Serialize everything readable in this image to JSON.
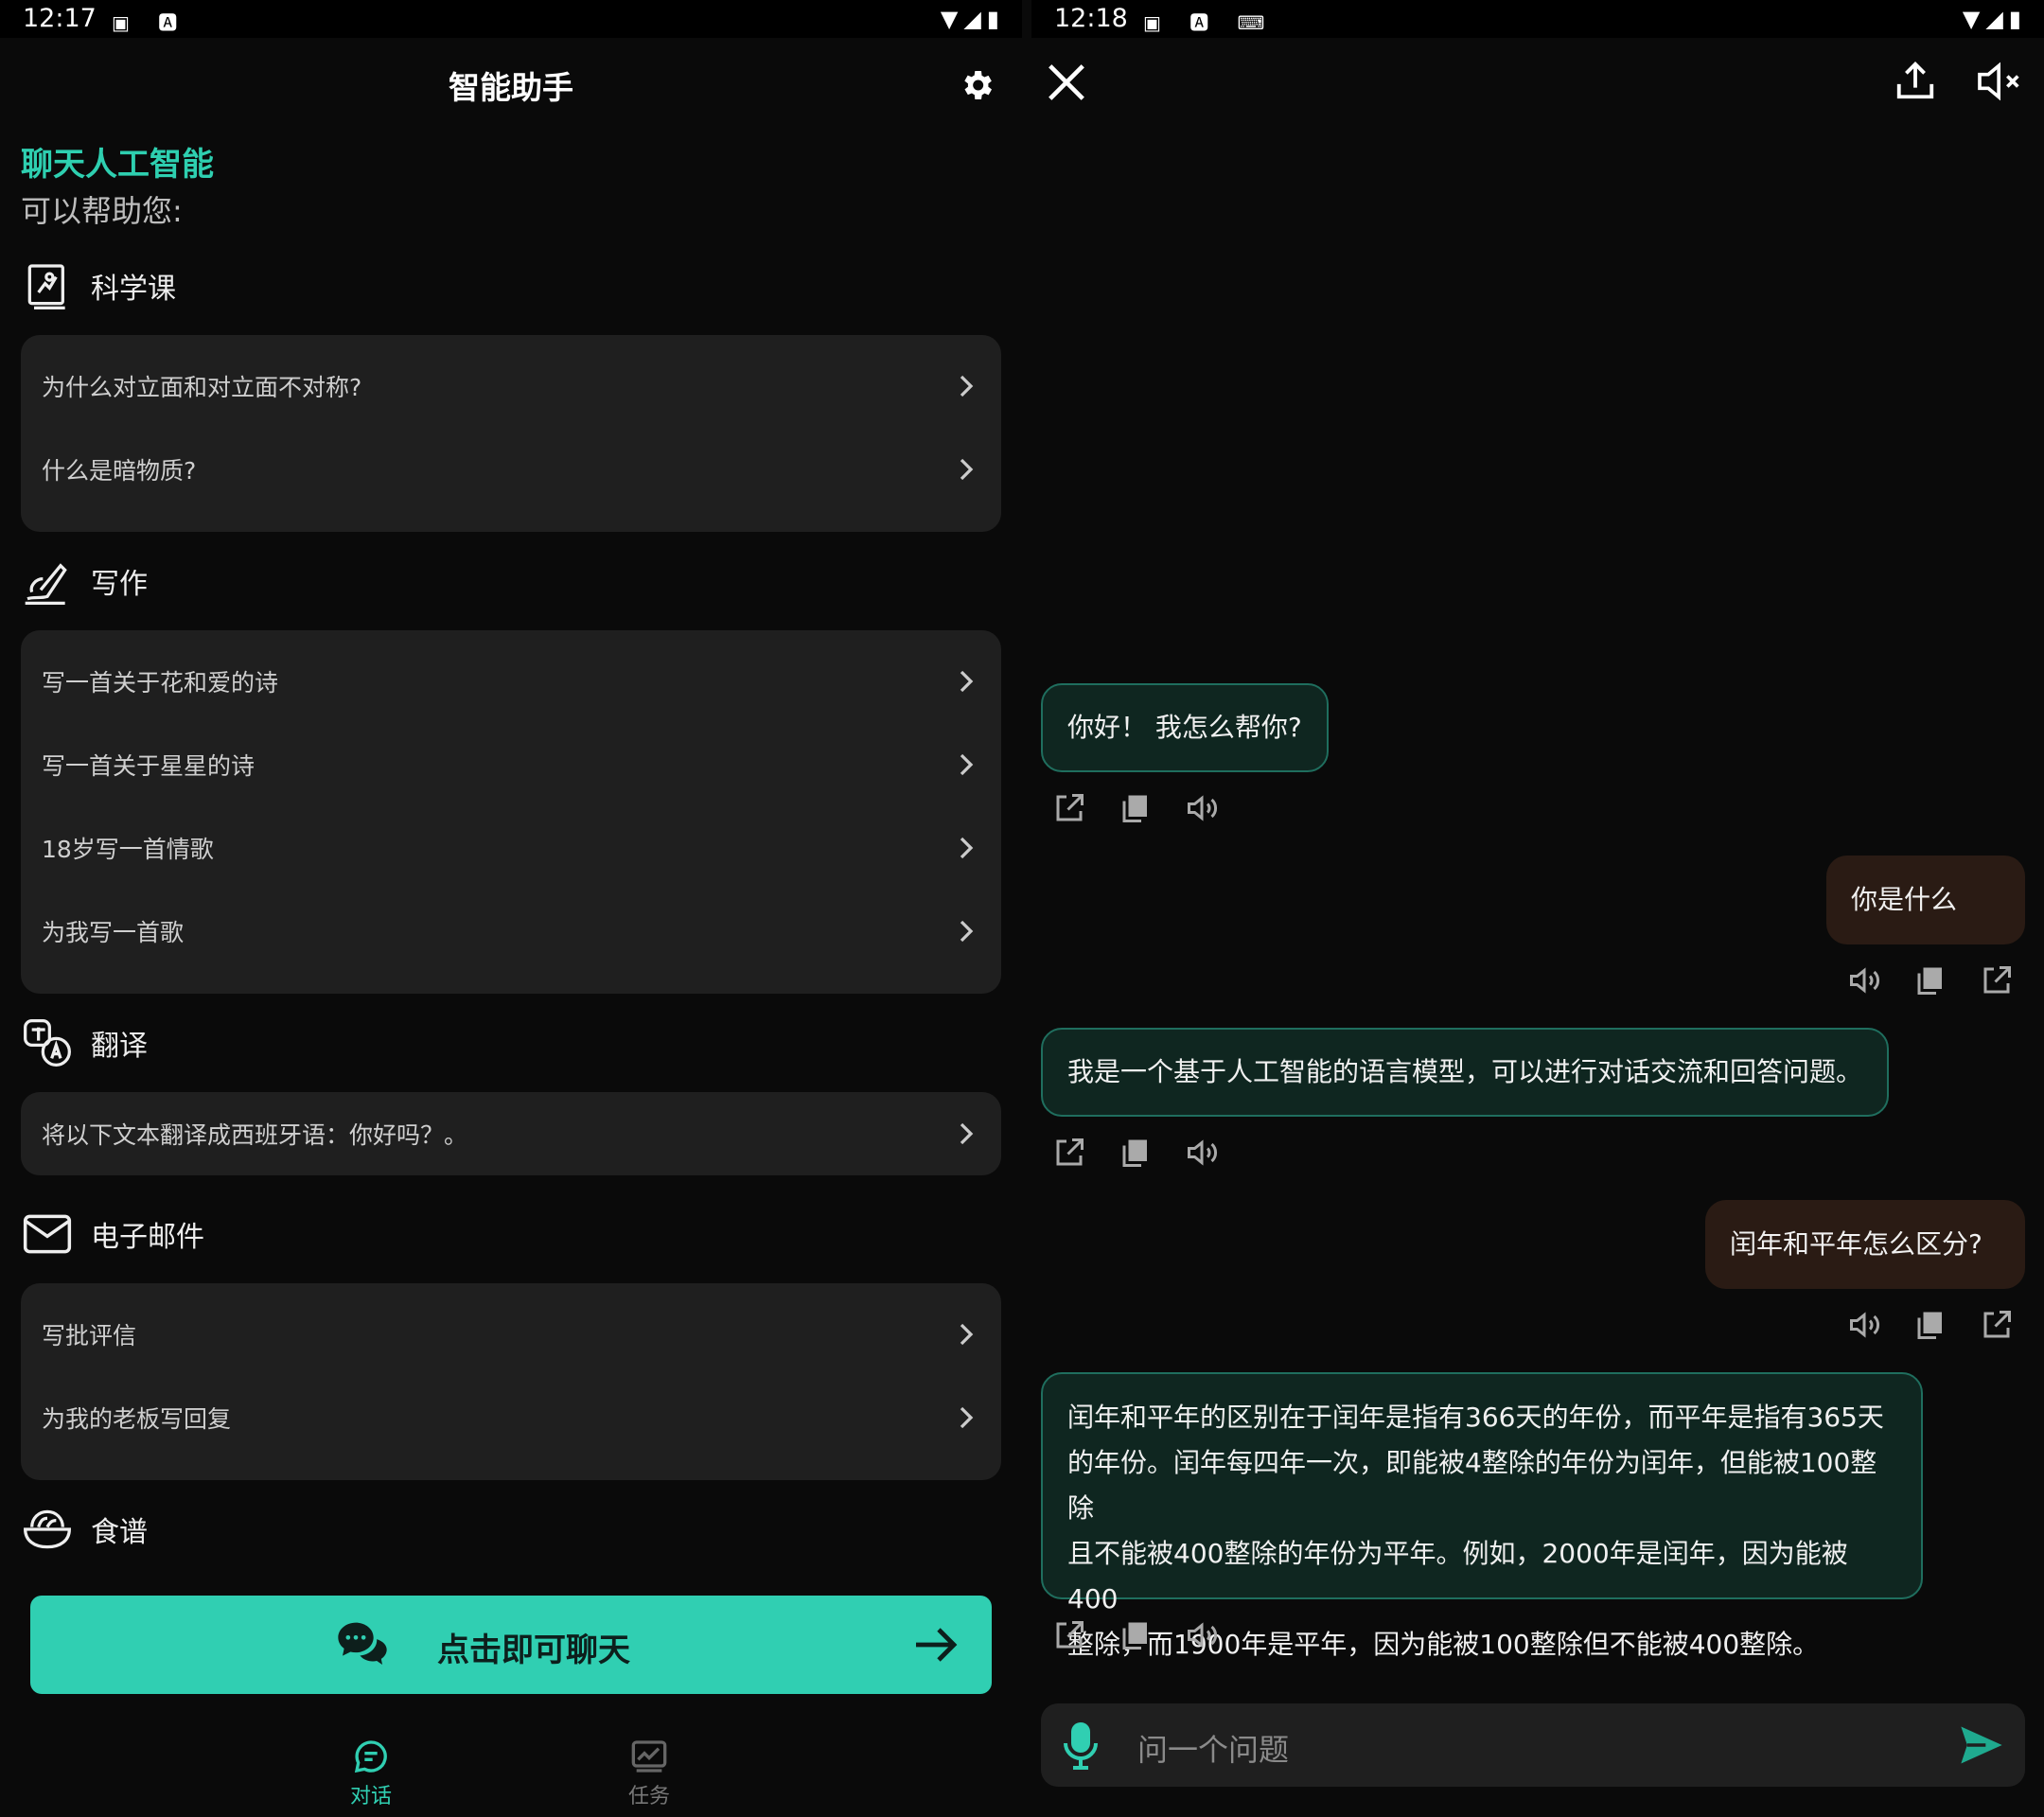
{
  "left": {
    "status": {
      "time": "12:17"
    },
    "header": {
      "title": "智能助手"
    },
    "intro": {
      "title": "聊天人工智能",
      "subtitle": "可以帮助您:"
    },
    "categories": [
      {
        "label": "科学课",
        "icon": "science-book-icon",
        "items": [
          "为什么对立面和对立面不对称?",
          "什么是暗物质?"
        ]
      },
      {
        "label": "写作",
        "icon": "writing-hand-icon",
        "items": [
          "写一首关于花和爱的诗",
          "写一首关于星星的诗",
          "18岁写一首情歌",
          "为我写一首歌"
        ]
      },
      {
        "label": "翻译",
        "icon": "translate-icon",
        "items": [
          "将以下文本翻译成西班牙语：你好吗？。"
        ]
      },
      {
        "label": "电子邮件",
        "icon": "email-icon",
        "items": [
          "写批评信",
          "为我的老板写回复"
        ]
      },
      {
        "label": "食谱",
        "icon": "recipe-bowl-icon",
        "items": []
      }
    ],
    "cta": {
      "label": "点击即可聊天"
    },
    "tabs": [
      {
        "label": "对话",
        "active": true
      },
      {
        "label": "任务",
        "active": false
      }
    ],
    "accent_color": "#30cfb2"
  },
  "right": {
    "status": {
      "time": "12:18"
    },
    "messages": [
      {
        "role": "bot",
        "text": "你好！ 我怎么帮你?"
      },
      {
        "role": "user",
        "text": "你是什么"
      },
      {
        "role": "bot",
        "text": "我是一个基于人工智能的语言模型，可以进行对话交流和回答问题。"
      },
      {
        "role": "user",
        "text": "闰年和平年怎么区分?"
      },
      {
        "role": "bot",
        "lines": [
          "闰年和平年的区别在于闰年是指有366天的年份，而平年是指有365天",
          "的年份。闰年每四年一次，即能被4整除的年份为闰年，但能被100整除",
          "且不能被400整除的年份为平年。例如，2000年是闰年，因为能被400",
          "整除，而1900年是平年，因为能被100整除但不能被400整除。"
        ]
      }
    ],
    "input": {
      "placeholder": "问一个问题"
    }
  }
}
